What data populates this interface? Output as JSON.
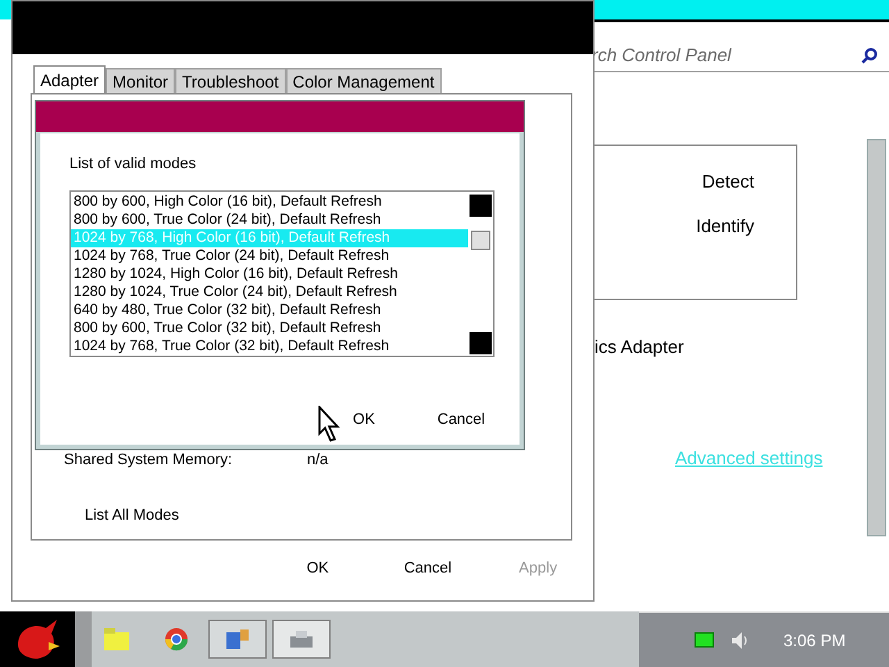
{
  "control_panel": {
    "search": {
      "placeholder": "rch Control Panel"
    },
    "buttons": [
      "Detect",
      "Identify"
    ],
    "adapter_text": "ics Adapter",
    "link": "Advanced settings"
  },
  "properties_dialog": {
    "tabs": [
      {
        "label": "Adapter",
        "selected": true
      },
      {
        "label": "Monitor",
        "selected": false
      },
      {
        "label": "Troubleshoot",
        "selected": false
      },
      {
        "label": "Color Management",
        "selected": false
      }
    ],
    "memory_label": "Shared System Memory:",
    "memory_value": "n/a",
    "list_button": "List All Modes",
    "buttons": [
      {
        "label": "OK",
        "disabled": false
      },
      {
        "label": "Cancel",
        "disabled": false
      },
      {
        "label": "Apply",
        "disabled": true
      }
    ]
  },
  "modes_dialog": {
    "label": "List of valid modes",
    "modes": [
      {
        "label": "800 by 600, High Color (16 bit), Default Refresh",
        "selected": false
      },
      {
        "label": "800 by 600, True Color (24 bit), Default Refresh",
        "selected": false
      },
      {
        "label": "1024 by 768, High Color (16 bit), Default Refresh",
        "selected": true
      },
      {
        "label": "1024 by 768, True Color (24 bit), Default Refresh",
        "selected": false
      },
      {
        "label": "1280 by 1024, High Color (16 bit), Default Refresh",
        "selected": false
      },
      {
        "label": "1280 by 1024, True Color (24 bit), Default Refresh",
        "selected": false
      },
      {
        "label": "640 by 480, True Color (32 bit), Default Refresh",
        "selected": false
      },
      {
        "label": "800 by 600, True Color (32 bit), Default Refresh",
        "selected": false
      },
      {
        "label": "1024 by 768, True Color (32 bit), Default Refresh",
        "selected": false
      }
    ],
    "buttons": [
      "OK",
      "Cancel"
    ]
  },
  "taskbar": {
    "clock": "3:06 PM"
  }
}
